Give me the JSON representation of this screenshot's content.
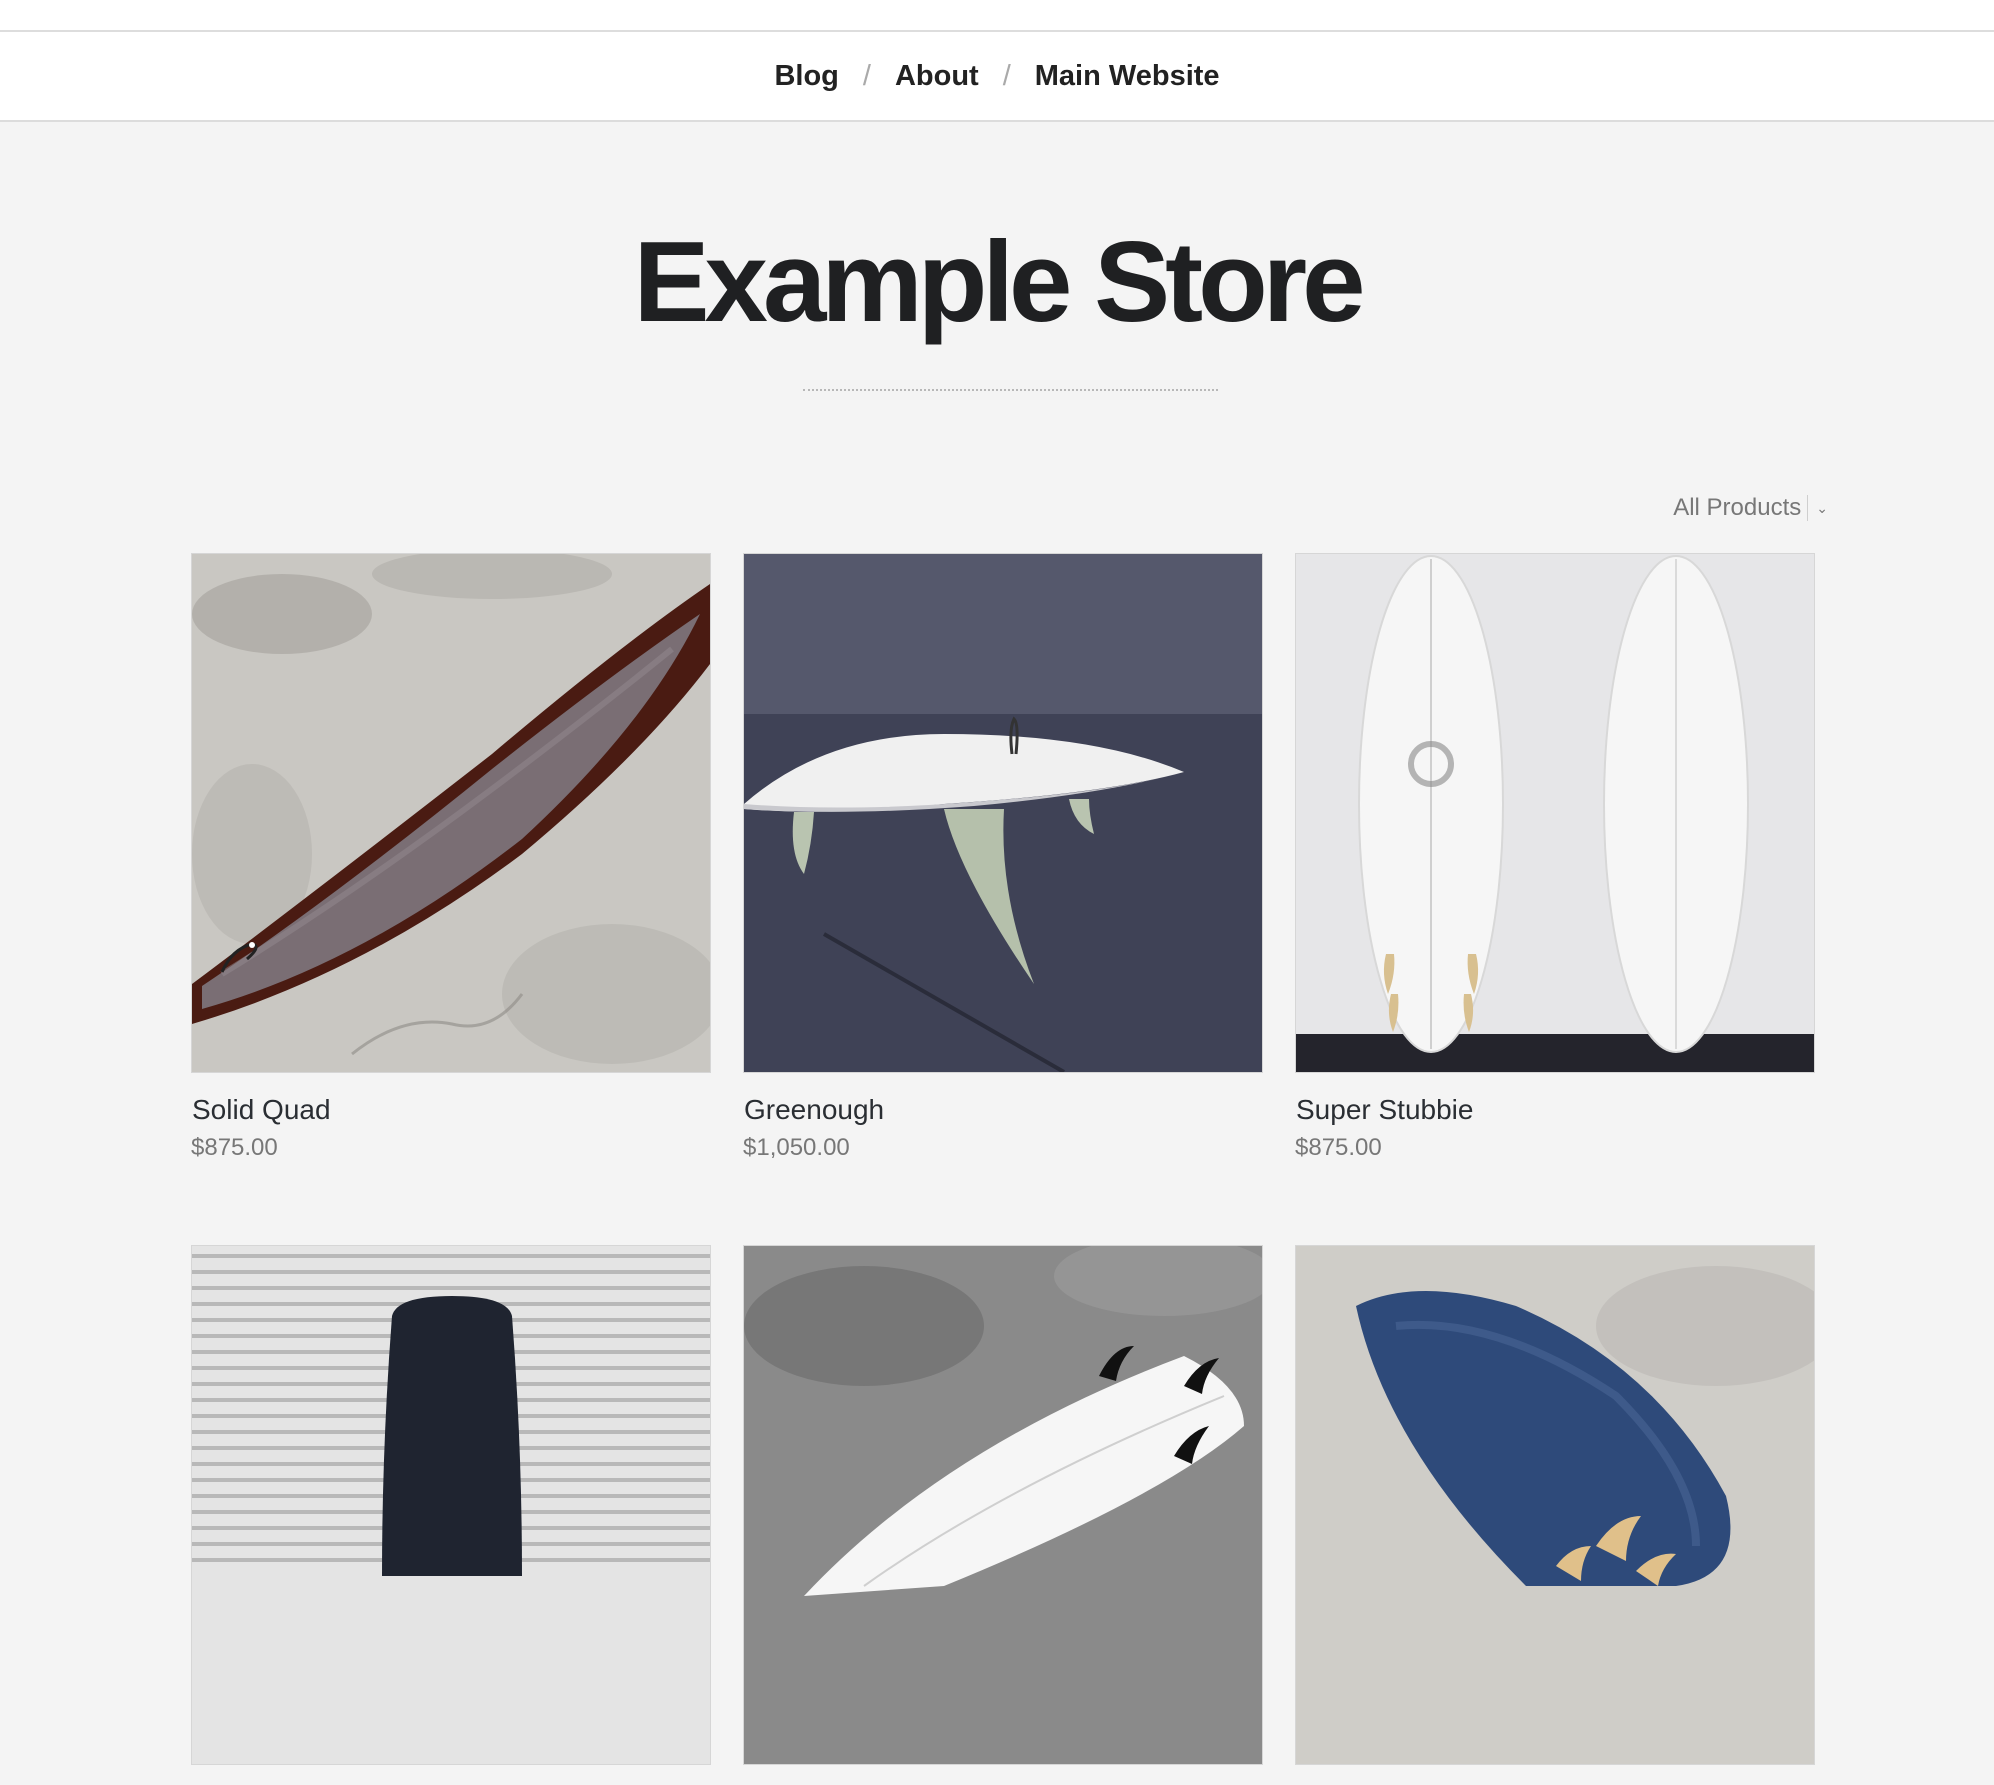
{
  "nav": {
    "items": [
      {
        "label": "Blog"
      },
      {
        "label": "About"
      },
      {
        "label": "Main Website"
      }
    ],
    "separator": "/"
  },
  "store": {
    "title": "Example Store"
  },
  "filter": {
    "label": "All Products",
    "chevron": "⌄"
  },
  "products": [
    {
      "name": "Solid Quad",
      "price": "$875.00"
    },
    {
      "name": "Greenough",
      "price": "$1,050.00"
    },
    {
      "name": "Super Stubbie",
      "price": "$875.00"
    },
    {
      "name": "",
      "price": ""
    },
    {
      "name": "",
      "price": ""
    },
    {
      "name": "",
      "price": ""
    }
  ],
  "colors": {
    "background": "#f4f4f4",
    "text": "#222222",
    "muted": "#777777"
  }
}
